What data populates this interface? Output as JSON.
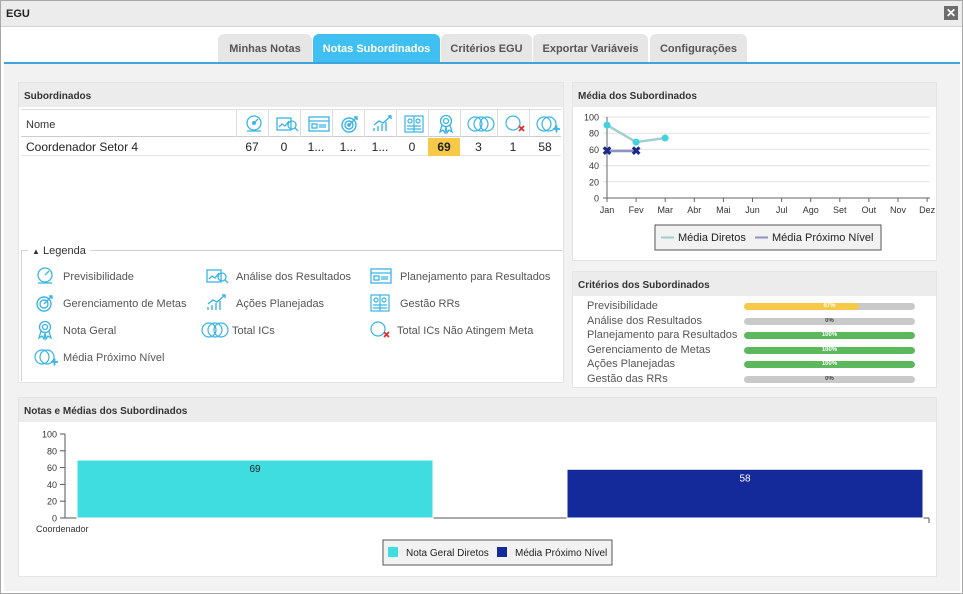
{
  "window": {
    "title": "EGU",
    "close_icon": "close-icon"
  },
  "tabs": [
    {
      "label": "Minhas Notas",
      "active": false
    },
    {
      "label": "Notas Subordinados",
      "active": true
    },
    {
      "label": "Critérios EGU",
      "active": false
    },
    {
      "label": "Exportar Variáveis",
      "active": false
    },
    {
      "label": "Configurações",
      "active": false
    }
  ],
  "subordinados": {
    "title": "Subordinados",
    "name_header": "Nome",
    "column_icons": [
      "previsibilidade-icon",
      "analise-resultados-icon",
      "planejamento-resultados-icon",
      "gerenciamento-metas-icon",
      "acoes-planejadas-icon",
      "gestao-rrs-icon",
      "nota-geral-icon",
      "total-ics-icon",
      "total-ics-nao-atingem-icon",
      "media-proximo-nivel-icon"
    ],
    "rows": [
      {
        "name": "Coordenador Setor 4",
        "values": [
          "67",
          "0",
          "1...",
          "1...",
          "1...",
          "0",
          "69",
          "3",
          "1",
          "58"
        ]
      }
    ],
    "highlight_color": "#f7c948"
  },
  "legenda": {
    "title": "Legenda",
    "toggle_icon": "triangle-up-icon",
    "items": [
      {
        "icon": "previsibilidade-icon",
        "label": "Previsibilidade"
      },
      {
        "icon": "analise-resultados-icon",
        "label": "Análise dos Resultados"
      },
      {
        "icon": "planejamento-resultados-icon",
        "label": "Planejamento para Resultados"
      },
      {
        "icon": "gerenciamento-metas-icon",
        "label": "Gerenciamento de Metas"
      },
      {
        "icon": "acoes-planejadas-icon",
        "label": "Ações Planejadas"
      },
      {
        "icon": "gestao-rrs-icon",
        "label": "Gestão RRs"
      },
      {
        "icon": "nota-geral-icon",
        "label": "Nota Geral"
      },
      {
        "icon": "total-ics-icon",
        "label": "Total ICs"
      },
      {
        "icon": "total-ics-nao-atingem-icon",
        "label": "Total ICs Não Atingem Meta"
      },
      {
        "icon": "media-proximo-nivel-icon",
        "label": "Média Próximo Nível"
      }
    ]
  },
  "media_panel": {
    "title": "Média dos Subordinados"
  },
  "criterios_panel": {
    "title": "Critérios dos Subordinados",
    "items": [
      {
        "label": "Previsibilidade",
        "percent": 67,
        "text": "67%",
        "color": "#f7c948"
      },
      {
        "label": "Análise dos Resultados",
        "percent": 0,
        "text": "0%",
        "color": "#c9c9c9"
      },
      {
        "label": "Planejamento para Resultados",
        "percent": 100,
        "text": "100%",
        "color": "#5cb85c"
      },
      {
        "label": "Gerenciamento de Metas",
        "percent": 100,
        "text": "100%",
        "color": "#5cb85c"
      },
      {
        "label": "Ações Planejadas",
        "percent": 100,
        "text": "100%",
        "color": "#5cb85c"
      },
      {
        "label": "Gestão das RRs",
        "percent": 0,
        "text": "0%",
        "color": "#c9c9c9"
      }
    ]
  },
  "notas_panel": {
    "title": "Notas e Médias dos Subordinados"
  },
  "chart_data": [
    {
      "type": "line",
      "x": [
        "Jan",
        "Fev",
        "Mar",
        "Abr",
        "Mai",
        "Jun",
        "Jul",
        "Ago",
        "Set",
        "Out",
        "Nov",
        "Dez"
      ],
      "ylim": [
        0,
        100
      ],
      "yticks": [
        0,
        20,
        40,
        60,
        80,
        100
      ],
      "grid": true,
      "legend": "bottom-center",
      "series": [
        {
          "name": "Média Diretos",
          "values": [
            90,
            69,
            74
          ],
          "color": "#40d3dc"
        },
        {
          "name": "Média Próximo Nível",
          "values": [
            58,
            58
          ],
          "color": "#1a2a8c"
        }
      ]
    },
    {
      "type": "bar",
      "categories": [
        "Coordenador"
      ],
      "ylim": [
        0,
        100
      ],
      "yticks": [
        0,
        20,
        40,
        60,
        80,
        100
      ],
      "legend": "bottom-center",
      "series": [
        {
          "name": "Nota Geral Diretos",
          "values": [
            69
          ],
          "color": "#40dde0"
        },
        {
          "name": "Média Próximo Nível",
          "values": [
            58
          ],
          "color": "#14299a"
        }
      ]
    }
  ]
}
